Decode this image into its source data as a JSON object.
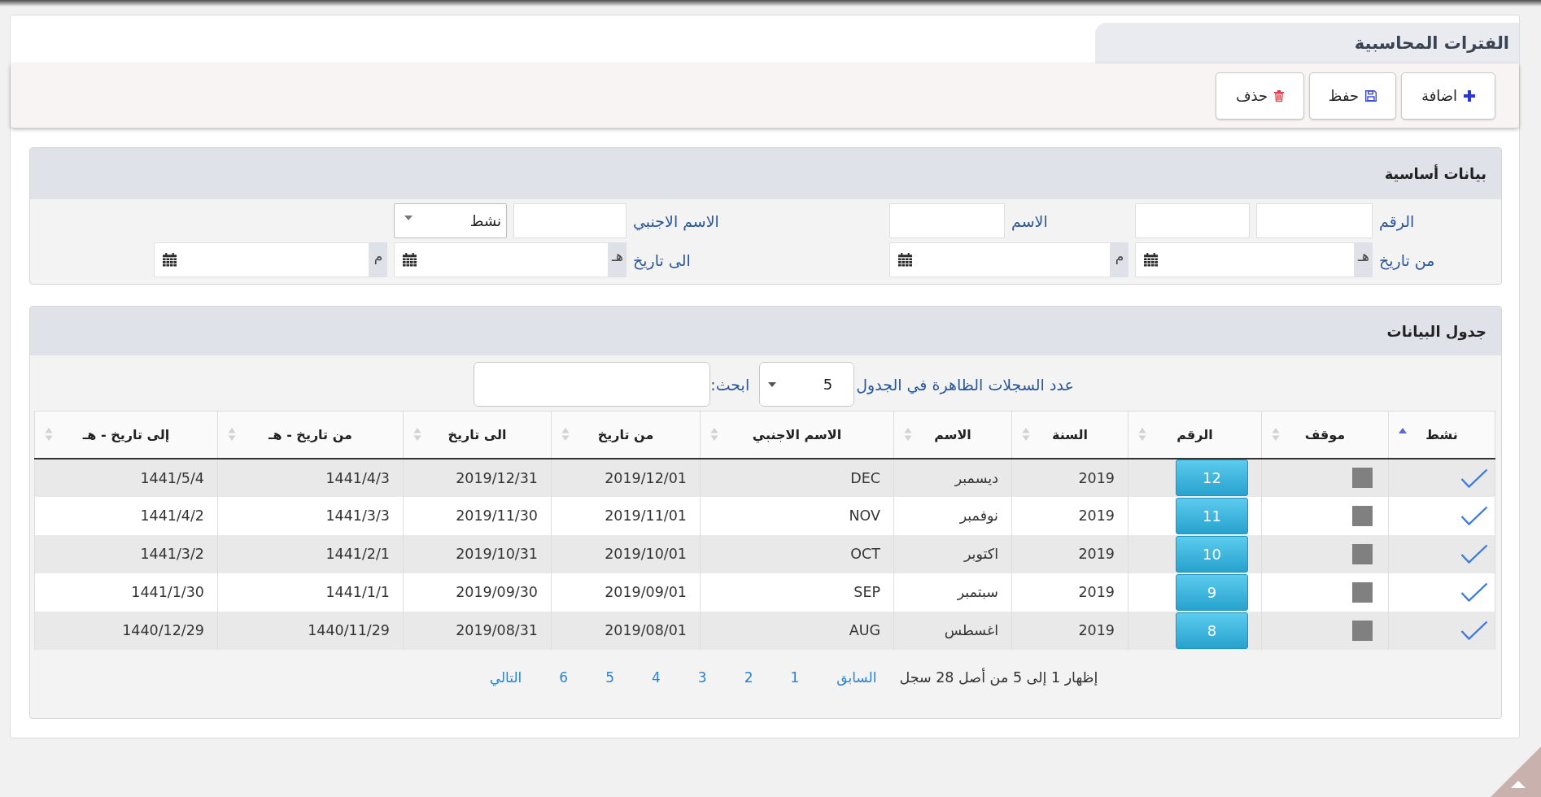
{
  "page_title": "الفترات المحاسبية",
  "toolbar": {
    "buttons": [
      {
        "kind": "add",
        "label": "اضافة"
      },
      {
        "kind": "save",
        "label": "حفظ"
      },
      {
        "kind": "delete",
        "label": "حذف"
      }
    ]
  },
  "basic_data": {
    "title": "بيانات أساسية",
    "fields": [
      {
        "label": "الرقم",
        "controls": [
          {
            "kind": "input"
          },
          {
            "kind": "input"
          }
        ]
      },
      {
        "label": "الاسم",
        "controls": [
          {
            "kind": "input"
          }
        ]
      },
      {
        "label": "الاسم الاجنبي",
        "controls": [
          {
            "kind": "input"
          },
          {
            "kind": "select",
            "value": "نشط"
          }
        ]
      },
      {
        "label": "من تاريخ",
        "controls": [
          {
            "kind": "date",
            "addon": "هـ"
          },
          {
            "kind": "date",
            "addon": "م"
          }
        ]
      },
      {
        "label": "الى تاريخ",
        "controls": [
          {
            "kind": "date",
            "addon": "هـ"
          },
          {
            "kind": "date",
            "addon": "م"
          }
        ]
      }
    ]
  },
  "data_table": {
    "title": "جدول البيانات",
    "page_size_label": "عدد السجلات الظاهرة في الجدول",
    "page_size": "5",
    "search_label": "ابحث:",
    "columns": [
      {
        "label": "نشط",
        "kind": "check",
        "sorted": true
      },
      {
        "label": "موقف",
        "kind": "box",
        "sorted": false
      },
      {
        "label": "الرقم",
        "kind": "button",
        "sorted": false
      },
      {
        "label": "السنة",
        "kind": "text",
        "sorted": false
      },
      {
        "label": "الاسم",
        "kind": "text",
        "sorted": false
      },
      {
        "label": "الاسم الاجنبي",
        "kind": "text",
        "sorted": false
      },
      {
        "label": "من تاريخ",
        "kind": "text",
        "sorted": false
      },
      {
        "label": "الى تاريخ",
        "kind": "text",
        "sorted": false
      },
      {
        "label": "من تاريخ - هـ",
        "kind": "text",
        "sorted": false
      },
      {
        "label": "إلى تاريخ - هـ",
        "kind": "text",
        "sorted": false
      }
    ],
    "rows": [
      {
        "cells": [
          {
            "checked": true
          },
          {
            "checked": false
          },
          {
            "text": "12"
          },
          {
            "text": "2019"
          },
          {
            "text": "ديسمبر"
          },
          {
            "text": "DEC"
          },
          {
            "text": "2019/12/01"
          },
          {
            "text": "2019/12/31"
          },
          {
            "text": "1441/4/3"
          },
          {
            "text": "1441/5/4"
          }
        ]
      },
      {
        "cells": [
          {
            "checked": true
          },
          {
            "checked": false
          },
          {
            "text": "11"
          },
          {
            "text": "2019"
          },
          {
            "text": "نوفمبر"
          },
          {
            "text": "NOV"
          },
          {
            "text": "2019/11/01"
          },
          {
            "text": "2019/11/30"
          },
          {
            "text": "1441/3/3"
          },
          {
            "text": "1441/4/2"
          }
        ]
      },
      {
        "cells": [
          {
            "checked": true
          },
          {
            "checked": false
          },
          {
            "text": "10"
          },
          {
            "text": "2019"
          },
          {
            "text": "اكتوبر"
          },
          {
            "text": "OCT"
          },
          {
            "text": "2019/10/01"
          },
          {
            "text": "2019/10/31"
          },
          {
            "text": "1441/2/1"
          },
          {
            "text": "1441/3/2"
          }
        ]
      },
      {
        "cells": [
          {
            "checked": true
          },
          {
            "checked": false
          },
          {
            "text": "9"
          },
          {
            "text": "2019"
          },
          {
            "text": "سبتمبر"
          },
          {
            "text": "SEP"
          },
          {
            "text": "2019/09/01"
          },
          {
            "text": "2019/09/30"
          },
          {
            "text": "1441/1/1"
          },
          {
            "text": "1441/1/30"
          }
        ]
      },
      {
        "cells": [
          {
            "checked": true
          },
          {
            "checked": false
          },
          {
            "text": "8"
          },
          {
            "text": "2019"
          },
          {
            "text": "اغسطس"
          },
          {
            "text": "AUG"
          },
          {
            "text": "2019/08/01"
          },
          {
            "text": "2019/08/31"
          },
          {
            "text": "1440/11/29"
          },
          {
            "text": "1440/12/29"
          }
        ]
      }
    ],
    "pagination": {
      "info": "إظهار 1 إلى 5 من أصل 28 سجل",
      "previous": "السابق",
      "pages": [
        "1",
        "2",
        "3",
        "4",
        "5",
        "6"
      ],
      "next": "التالي"
    }
  }
}
